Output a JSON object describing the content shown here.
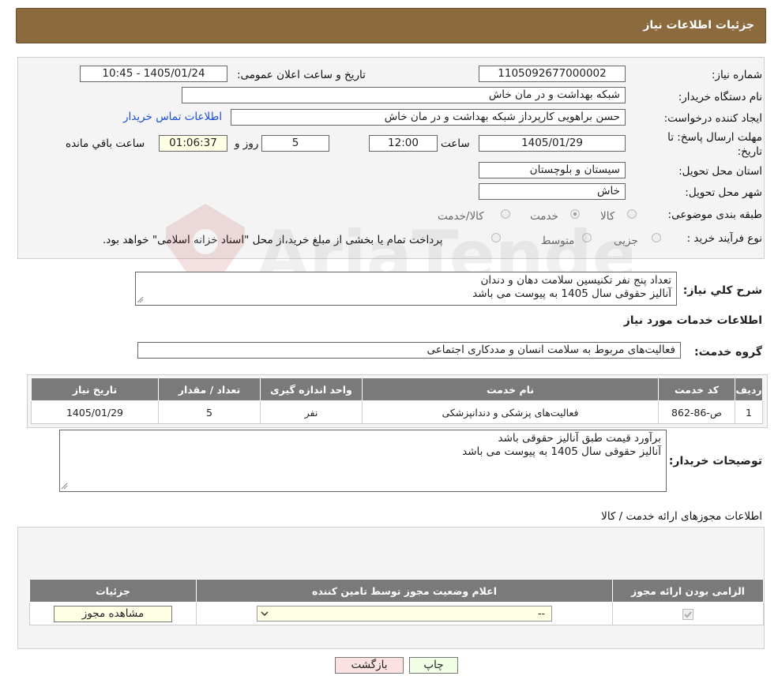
{
  "header": {
    "title": "جزئیات اطلاعات نیاز"
  },
  "form": {
    "need_number_label": "شماره نیاز:",
    "need_number": "1105092677000002",
    "announce_label": "تاریخ و ساعت اعلان عمومی:",
    "announce_value": "1405/01/24 - 10:45",
    "buyer_org_label": "نام دستگاه خریدار:",
    "buyer_org": "شبکه بهداشت و در مان خاش",
    "requester_label": "ایجاد کننده درخواست:",
    "requester": "حسن براهویی کارپرداز شبکه بهداشت و در مان خاش",
    "contact_link": "اطلاعات تماس خریدار",
    "deadline_label": "مهلت ارسال پاسخ: تا تاریخ:",
    "deadline_date": "1405/01/29",
    "time_label": "ساعت",
    "deadline_time": "12:00",
    "days_value": "5",
    "days_label": "روز و",
    "remaining_value": "01:06:37",
    "remaining_label": "ساعت باقي مانده",
    "province_label": "استان محل تحویل:",
    "province": "سیستان و بلوچستان",
    "city_label": "شهر محل تحویل:",
    "city": "خاش",
    "category_label": "طبقه بندی موضوعی:",
    "category_options": [
      "کالا",
      "خدمت",
      "کالا/خدمت"
    ],
    "category_selected": "خدمت",
    "process_label": "نوع فرآیند خرید :",
    "process_options": [
      "جزیی",
      "متوسط"
    ],
    "process_note": "پرداخت تمام یا بخشی از مبلغ خرید،از محل \"اسناد خزانه اسلامی\" خواهد بود."
  },
  "summary": {
    "label": "شرح کلي نياز:",
    "line1": "تعداد پنج نفر تکنیسین سلامت دهان و دندان",
    "line2": "آنالیز حقوقی سال 1405 به پیوست می باشد"
  },
  "services": {
    "section_title": "اطلاعات خدمات مورد نیاز",
    "group_label": "گروه خدمت:",
    "group_value": "فعالیت‌های مربوط به سلامت انسان و مددکاری اجتماعی",
    "columns": [
      "ردیف",
      "کد خدمت",
      "نام خدمت",
      "واحد اندازه گیری",
      "تعداد / مقدار",
      "تاریخ نیاز"
    ],
    "rows": [
      {
        "row": "1",
        "code": "ص-86-862",
        "name": "فعالیت‌های پزشکی و دندانپزشکی",
        "unit": "نفر",
        "qty": "5",
        "date": "1405/01/29"
      }
    ]
  },
  "buyer_notes": {
    "label": "توضیحات خریدار:",
    "line1": "برآورد قیمت طبق آنالیز حقوقی باشد",
    "line2": "آنالیز حقوقی سال 1405 به پیوست می باشد"
  },
  "licenses": {
    "section_title": "اطلاعات مجوزهای ارائه خدمت / کالا",
    "columns": [
      "الزامی بودن ارائه مجوز",
      "اعلام وضعیت مجوز توسط تامین کننده",
      "جزئیات"
    ],
    "select_value": "--",
    "view_button": "مشاهده مجوز"
  },
  "actions": {
    "print": "چاپ",
    "back": "بازگشت"
  },
  "watermark": {
    "text": "AriaTender.neT"
  },
  "colors": {
    "header_bg": "#8b6a3e",
    "table_header_bg": "#7a7a7a",
    "back_button_bg": "#fbe1e1",
    "print_button_bg": "#f0ffe4"
  }
}
